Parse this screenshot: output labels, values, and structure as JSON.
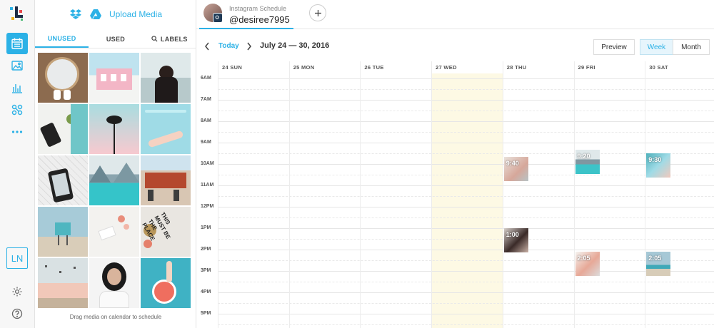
{
  "colors": {
    "accent": "#2bb1e6",
    "wednesday_highlight": "#fdf9e4"
  },
  "rail": {
    "logo_icon": "brand-logo-icon",
    "items": [
      {
        "icon": "calendar-icon",
        "active": true
      },
      {
        "icon": "image-icon",
        "active": false
      },
      {
        "icon": "bar-chart-icon",
        "active": false
      },
      {
        "icon": "network-icon",
        "active": false
      },
      {
        "icon": "more-icon",
        "active": false
      }
    ],
    "user_initials": "LN",
    "settings_icon": "gear-icon",
    "help_icon": "help-icon"
  },
  "media_panel": {
    "upload_label": "Upload Media",
    "upload_icons": [
      "dropbox-icon",
      "google-drive-icon"
    ],
    "tabs": [
      {
        "label": "UNUSED",
        "active": true
      },
      {
        "label": "USED",
        "active": false
      },
      {
        "label": "LABELS",
        "active": false,
        "icon": "search-icon"
      }
    ],
    "thumbnails": [
      "mirror-sneakers",
      "pink-building",
      "woman-selfie",
      "phone-desk",
      "palm-tree",
      "pool-legs",
      "phone-hand",
      "mountain-lake",
      "cafe-street",
      "lifeguard-tower",
      "flowers-desk",
      "this-must-be-the-place",
      "beach-birds",
      "woman-portrait",
      "pool-grapefruit"
    ],
    "thumbnail_overlay_text": "THIS MUST BE THE PLACE",
    "drag_hint": "Drag media on calendar to schedule"
  },
  "header": {
    "account_subtitle": "Instagram Schedule",
    "account_name": "@desiree7995",
    "add_icon": "plus-icon"
  },
  "toolbar": {
    "today_label": "Today",
    "range_label": "July 24 — 30, 2016",
    "prev_icon": "chevron-left-icon",
    "next_icon": "chevron-right-icon",
    "preview_label": "Preview",
    "week_label": "Week",
    "month_label": "Month",
    "active_view": "Week"
  },
  "calendar": {
    "days": [
      "24 SUN",
      "25 MON",
      "26 TUE",
      "27 WED",
      "28 THU",
      "29 FRI",
      "30 SAT"
    ],
    "highlight_day": "27 WED",
    "hours": [
      "6AM",
      "7AM",
      "8AM",
      "9AM",
      "10AM",
      "11AM",
      "12PM",
      "1PM",
      "2PM",
      "3PM",
      "4PM",
      "5PM"
    ],
    "posts": [
      {
        "day": "28 THU",
        "time": "9:40",
        "image": "coffee-cup"
      },
      {
        "day": "29 FRI",
        "time": "9:20",
        "image": "mountain-lake"
      },
      {
        "day": "30 SAT",
        "time": "9:30",
        "image": "pool-legs"
      },
      {
        "day": "28 THU",
        "time": "1:00",
        "image": "woman-selfie"
      },
      {
        "day": "29 FRI",
        "time": "2:05",
        "image": "flowers-desk"
      },
      {
        "day": "30 SAT",
        "time": "2:05",
        "image": "lifeguard-tower"
      }
    ]
  }
}
